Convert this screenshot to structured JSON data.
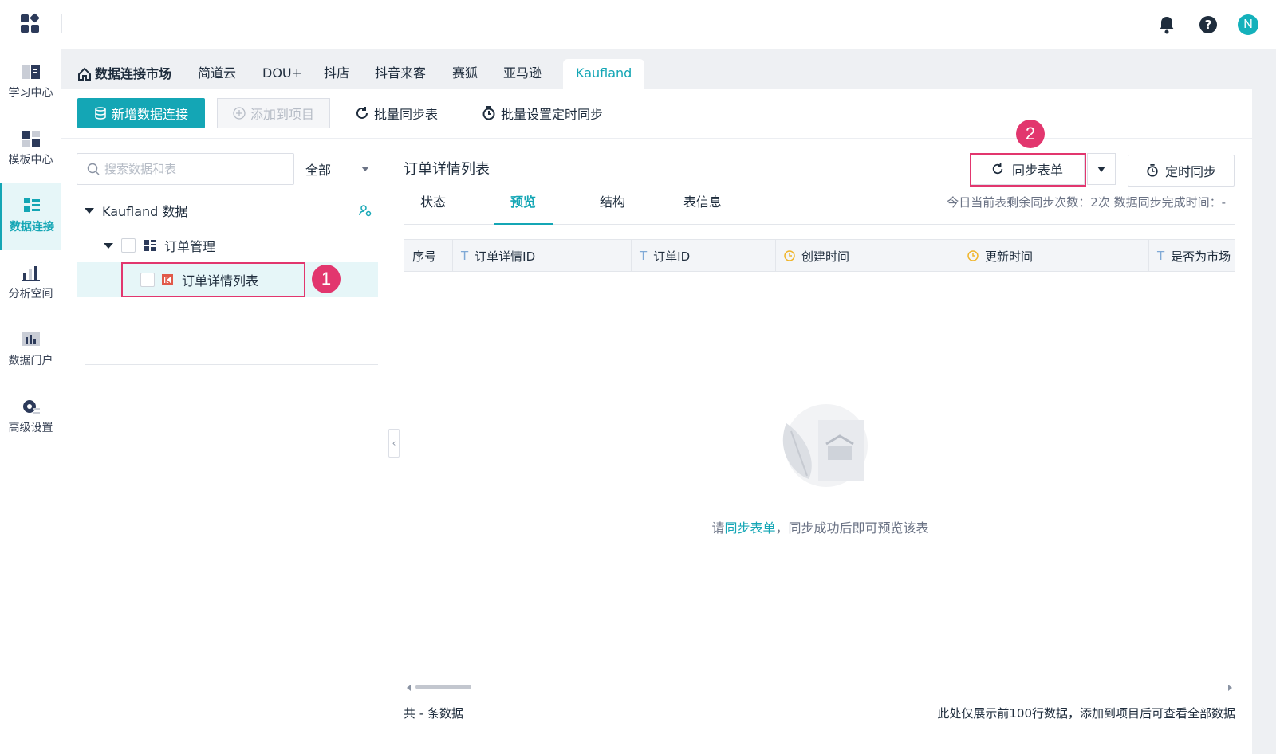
{
  "header": {
    "icons": [
      "bell-icon",
      "help-icon"
    ],
    "avatar_initial": "N"
  },
  "rail": {
    "items": [
      {
        "label": "学习中心",
        "icon": "book-icon"
      },
      {
        "label": "模板中心",
        "icon": "template-icon"
      },
      {
        "label": "数据连接",
        "icon": "data-connect-icon",
        "active": true
      },
      {
        "label": "分析空间",
        "icon": "analysis-icon"
      },
      {
        "label": "数据门户",
        "icon": "portal-icon"
      },
      {
        "label": "高级设置",
        "icon": "gear-icon"
      }
    ]
  },
  "tabs": {
    "home": "数据连接市场",
    "items": [
      "简道云",
      "DOU+",
      "抖店",
      "抖音来客",
      "赛狐",
      "亚马逊",
      "Kaufland"
    ],
    "active": "Kaufland"
  },
  "toolbar": {
    "add_connection": "新增数据连接",
    "add_to_project": "添加到项目",
    "batch_sync": "批量同步表",
    "batch_schedule": "批量设置定时同步"
  },
  "tree": {
    "search_placeholder": "搜索数据和表",
    "filter_value": "全部",
    "root": "Kaufland 数据",
    "group": "订单管理",
    "table": "订单详情列表"
  },
  "content": {
    "title": "订单详情列表",
    "sync_button": "同步表单",
    "schedule_button": "定时同步",
    "tabs": [
      "状态",
      "预览",
      "结构",
      "表信息"
    ],
    "active_tab": "预览",
    "info": "今日当前表剩余同步次数：2次   数据同步完成时间：-",
    "columns": [
      {
        "label": "序号",
        "type": ""
      },
      {
        "label": "订单详情ID",
        "type": "T"
      },
      {
        "label": "订单ID",
        "type": "T"
      },
      {
        "label": "创建时间",
        "type": "clock"
      },
      {
        "label": "更新时间",
        "type": "clock"
      },
      {
        "label": "是否为市场",
        "type": "T"
      }
    ],
    "empty_prefix": "请",
    "empty_link": "同步表单",
    "empty_suffix": "，同步成功后即可预览该表",
    "footer_left": "共 - 条数据",
    "footer_right": "此处仅展示前100行数据，添加到项目后可查看全部数据"
  },
  "annotations": {
    "step1": "1",
    "step2": "2",
    "highlight_color": "#e2366e"
  },
  "colors": {
    "accent": "#14a6b5",
    "avatar": "#14b1bb",
    "clock": "#f0b52b"
  }
}
